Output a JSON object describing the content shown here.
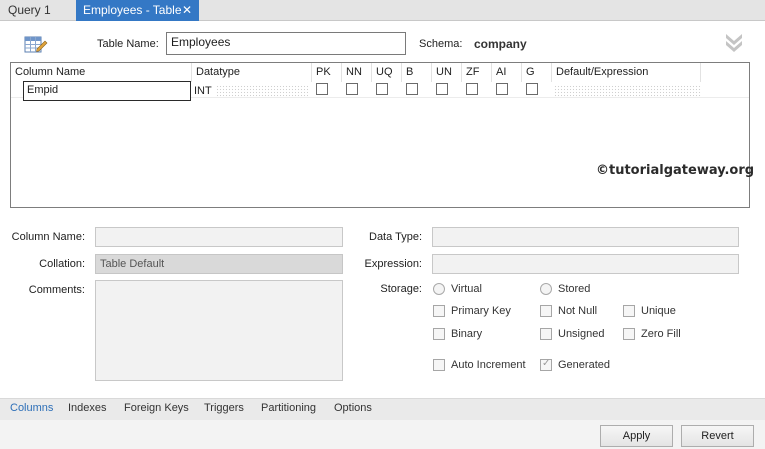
{
  "tabs": [
    {
      "label": "Query 1"
    },
    {
      "label": "Employees - Table",
      "close": "✕"
    }
  ],
  "header": {
    "table_name_label": "Table Name:",
    "table_name_value": "Employees",
    "schema_label": "Schema:",
    "schema_value": "company"
  },
  "grid": {
    "columns": [
      "Column Name",
      "Datatype",
      "PK",
      "NN",
      "UQ",
      "B",
      "UN",
      "ZF",
      "AI",
      "G",
      "Default/Expression"
    ],
    "rows": [
      {
        "name": "Empid",
        "datatype": "INT",
        "flags": [
          false,
          false,
          false,
          false,
          false,
          false,
          false,
          false
        ]
      }
    ],
    "watermark": "©tutorialgateway.org"
  },
  "details": {
    "column_name_label": "Column Name:",
    "collation_label": "Collation:",
    "collation_value": "Table Default",
    "comments_label": "Comments:",
    "data_type_label": "Data Type:",
    "expression_label": "Expression:",
    "storage_label": "Storage:",
    "storage_options": [
      "Virtual",
      "Stored"
    ],
    "flags": {
      "primary_key": "Primary Key",
      "not_null": "Not Null",
      "unique": "Unique",
      "binary": "Binary",
      "unsigned": "Unsigned",
      "zero_fill": "Zero Fill",
      "auto_increment": "Auto Increment",
      "generated": "Generated"
    }
  },
  "bottom_tabs": [
    "Columns",
    "Indexes",
    "Foreign Keys",
    "Triggers",
    "Partitioning",
    "Options"
  ],
  "buttons": {
    "apply": "Apply",
    "revert": "Revert"
  },
  "colors": {
    "accent": "#3478c5",
    "active_tab_text": "#2d6fb8"
  },
  "icons": {
    "table": "table-edit-icon",
    "collapse": "double-chevron-down-icon"
  }
}
